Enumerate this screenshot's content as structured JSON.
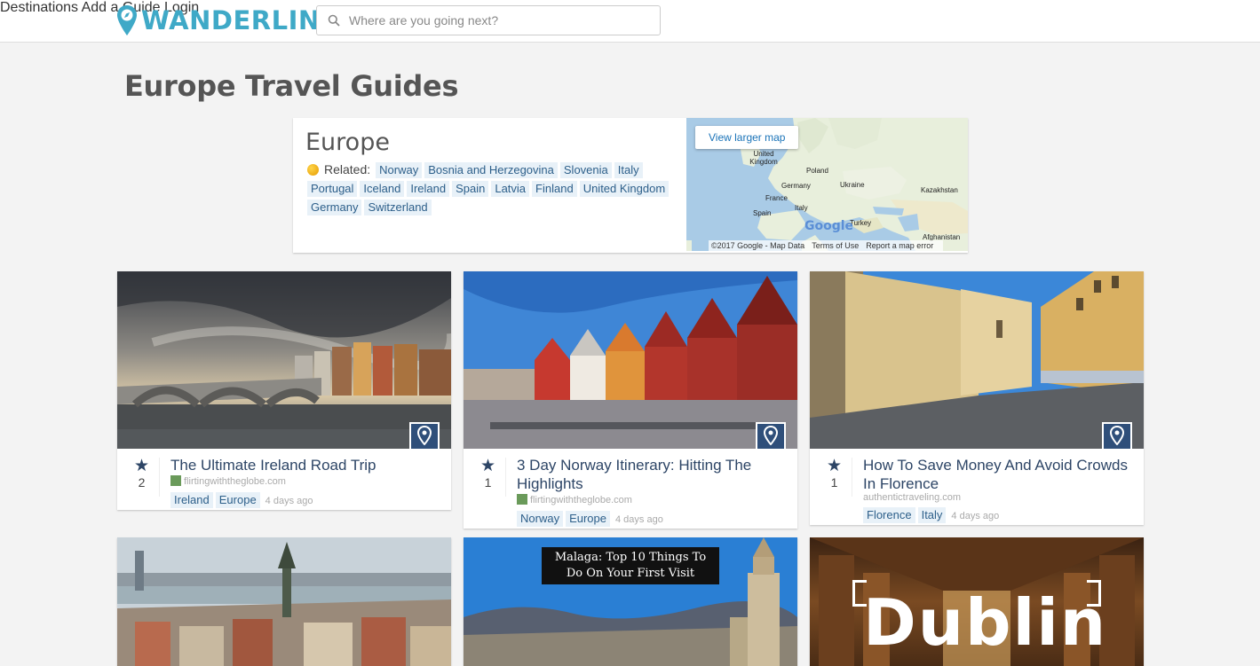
{
  "header": {
    "logo_text": "WANDERLING",
    "search_placeholder": "Where are you going next?",
    "nav": [
      "Destinations",
      "Add a Guide",
      "Login"
    ]
  },
  "page": {
    "title": "Europe Travel Guides"
  },
  "region": {
    "name": "Europe",
    "related_label": "Related:",
    "related": [
      "Norway",
      "Bosnia and Herzegovina",
      "Slovenia",
      "Italy",
      "Portugal",
      "Iceland",
      "Ireland",
      "Spain",
      "Latvia",
      "Finland",
      "United Kingdom",
      "Germany",
      "Switzerland"
    ],
    "map": {
      "button": "View larger map",
      "labels": [
        "United Kingdom",
        "Poland",
        "Germany",
        "Ukraine",
        "Kazakhstan",
        "France",
        "Italy",
        "Spain",
        "Turkey",
        "Afghanistan"
      ],
      "google": "Google",
      "attribution": [
        "©2017 Google - Map Data",
        "Terms of Use",
        "Report a map error"
      ]
    }
  },
  "guides": [
    {
      "title": "The Ultimate Ireland Road Trip",
      "votes": "2",
      "source": "flirtingwiththeglobe.com",
      "tags": [
        "Ireland",
        "Europe"
      ],
      "age": "4 days ago"
    },
    {
      "title": "3 Day Norway Itinerary: Hitting The Highlights",
      "votes": "1",
      "source": "flirtingwiththeglobe.com",
      "tags": [
        "Norway",
        "Europe"
      ],
      "age": "4 days ago"
    },
    {
      "title": "How To Save Money And Avoid Crowds In Florence",
      "votes": "1",
      "source": "authentictraveling.com",
      "tags": [
        "Florence",
        "Italy"
      ],
      "age": "4 days ago"
    },
    {
      "overlay": ""
    },
    {
      "overlay": "Malaga: Top 10 Things To Do On Your First Visit"
    },
    {
      "overlay": "Dublin"
    }
  ],
  "colors": {
    "brand": "#3fa9c7",
    "link": "#2d4566",
    "tag_bg": "#e8f1f8",
    "pin_btn": "#2f4f7a"
  }
}
